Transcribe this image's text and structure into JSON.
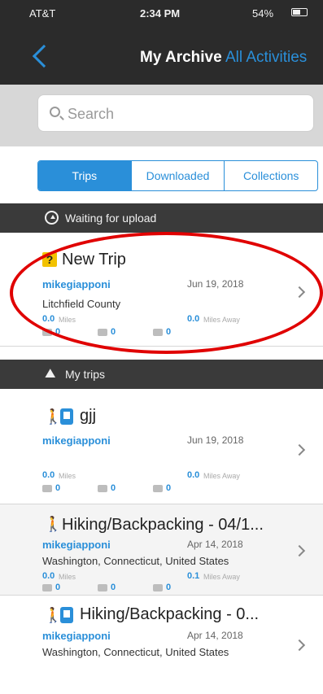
{
  "status": {
    "carrier": "AT&T",
    "time": "2:34 PM",
    "battery": "54%"
  },
  "nav": {
    "title": "My Archive",
    "right": "All Activities"
  },
  "search": {
    "placeholder": "Search"
  },
  "tabs": [
    "Trips",
    "Downloaded",
    "Collections"
  ],
  "sections": {
    "waiting": "Waiting for upload",
    "my_trips": "My trips"
  },
  "waiting_trip": {
    "title": "New Trip",
    "user": "mikegiapponi",
    "date": "Jun 19, 2018",
    "location": "Litchfield County",
    "distance": "0.0",
    "distance_unit": "Miles",
    "speed": "0.0",
    "speed_unit": "Miles Away",
    "counts": [
      "0",
      "0",
      "0"
    ]
  },
  "trips": [
    {
      "title": "gjj",
      "user": "mikegiapponi",
      "date": "Jun 19, 2018",
      "location": "",
      "distance": "0.0",
      "distance_unit": "Miles",
      "speed": "0.0",
      "speed_unit": "Miles Away",
      "counts": [
        "0",
        "0",
        "0"
      ]
    },
    {
      "title": "Hiking/Backpacking - 04/1...",
      "user": "mikegiapponi",
      "date": "Apr 14, 2018",
      "location": "Washington, Connecticut, United States",
      "distance": "0.0",
      "distance_unit": "Miles",
      "speed": "0.1",
      "speed_unit": "Miles Away",
      "counts": [
        "0",
        "0",
        "0"
      ]
    },
    {
      "title": "Hiking/Backpacking - 0...",
      "user": "mikegiapponi",
      "date": "Apr 14, 2018",
      "location": "Washington, Connecticut, United States",
      "distance": "",
      "distance_unit": "",
      "speed": "",
      "speed_unit": "",
      "counts": []
    }
  ],
  "colors": {
    "accent": "#2a8fd9",
    "header_bg": "#2b2b2b",
    "annotation": "#e00000"
  }
}
